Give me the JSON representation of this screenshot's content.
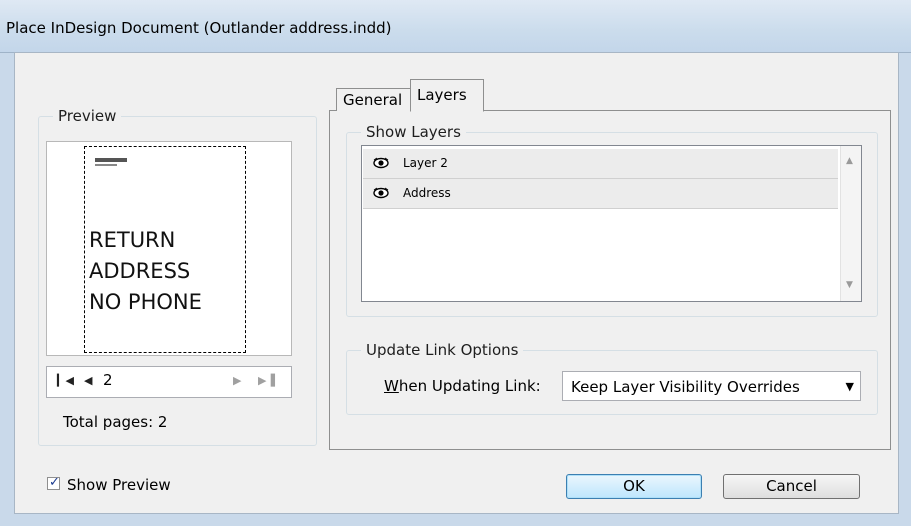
{
  "window": {
    "title": "Place InDesign Document (Outlander address.indd)"
  },
  "preview": {
    "group_label": "Preview",
    "page_lines": [
      "RETURN",
      "ADDRESS",
      "NO PHONE"
    ],
    "current_page": "2",
    "total_pages_label": "Total pages: 2"
  },
  "tabs": [
    {
      "label": "General",
      "active": false
    },
    {
      "label": "Layers",
      "active": true
    }
  ],
  "layers": {
    "group_label": "Show Layers",
    "items": [
      {
        "name": "Layer 2",
        "visible": true
      },
      {
        "name": "Address",
        "visible": true
      }
    ]
  },
  "update_link": {
    "group_label": "Update Link Options",
    "field_label_accel": "W",
    "field_label_rest": "hen Updating Link:",
    "selected": "Keep Layer Visibility Overrides"
  },
  "show_preview": {
    "label": "Show Preview",
    "checked": true
  },
  "buttons": {
    "ok": "OK",
    "cancel": "Cancel"
  }
}
